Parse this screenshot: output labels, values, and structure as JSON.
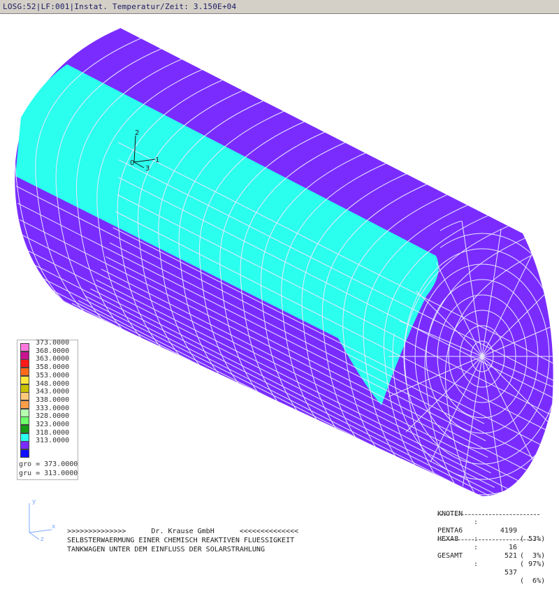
{
  "title": "LOSG:52|LF:001|Instat. Temperatur/Zeit: 3.150E+04",
  "colors": {
    "shell": "#7a2cff",
    "hot_band": "#2bffee",
    "mesh_lines": "#e8e8ff"
  },
  "legend": {
    "items": [
      {
        "color": "#ff78dc",
        "value": "373.0000"
      },
      {
        "color": "#c8138e",
        "value": "368.0000"
      },
      {
        "color": "#ff1a1a",
        "value": "363.0000"
      },
      {
        "color": "#ff6a1a",
        "value": "358.0000"
      },
      {
        "color": "#ffe63d",
        "value": "353.0000"
      },
      {
        "color": "#c8c000",
        "value": "348.0000"
      },
      {
        "color": "#ffc97a",
        "value": "343.0000"
      },
      {
        "color": "#ff9e4a",
        "value": "338.0000"
      },
      {
        "color": "#b7ffb0",
        "value": "333.0000"
      },
      {
        "color": "#6dff6a",
        "value": "328.0000"
      },
      {
        "color": "#169a16",
        "value": "323.0000"
      },
      {
        "color": "#2bffee",
        "value": "318.0000"
      },
      {
        "color": "#7a2cff",
        "value": "313.0000"
      },
      {
        "color": "#1010ff",
        "value": ""
      }
    ],
    "gro": "gro = 373.0000",
    "gru": "gru = 313.0000"
  },
  "triad": {
    "axis1": "1",
    "axis2": "2",
    "axis3": "3",
    "origin": "0"
  },
  "mini_triad": {
    "y": "y",
    "x": "x",
    "z": "z"
  },
  "footer": {
    "line1": ">>>>>>>>>>>>>>      Dr. Krause GmbH      <<<<<<<<<<<<<<",
    "line2": "SELBSTERWAERMUNG EINER CHEMISCH REAKTIVEN FLUESSIGKEIT",
    "line3": "TANKWAGEN UNTER DEM EINFLUSS DER SOLARSTRAHLUNG"
  },
  "stats": {
    "rows": [
      {
        "label": "KNOTEN",
        "value": "4199",
        "pct": "( 53%)"
      },
      {
        "label": "PENTA6",
        "value": "16",
        "pct": "(  3%)"
      },
      {
        "label": "HEXA8",
        "value": "521",
        "pct": "( 97%)"
      },
      {
        "label": "GESAMT",
        "value": "537",
        "pct": "(  6%)"
      }
    ]
  }
}
